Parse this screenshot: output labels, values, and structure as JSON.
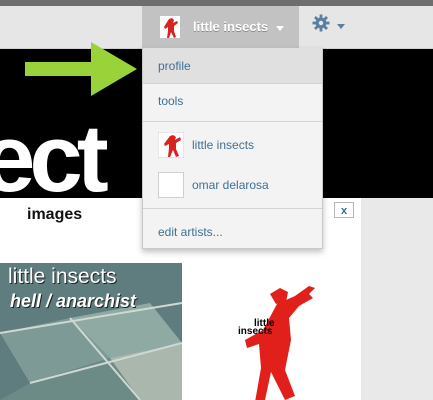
{
  "topbar": {
    "username": "little insects",
    "user_avatar_icon": "artist-avatar-icon",
    "gear_icon": "gear-icon"
  },
  "hero": {
    "text": "ect"
  },
  "content": {
    "images_label": "images",
    "close_label": "x",
    "album_title": "little insects",
    "album_subtitle": "hell / anarchist",
    "art_label_line1": "little",
    "art_label_line2": "insects"
  },
  "dropdown": {
    "items": [
      {
        "label": "profile",
        "active": true
      },
      {
        "label": "tools"
      },
      {
        "label": "little insects",
        "icon": "artist-avatar-icon"
      },
      {
        "label": "omar delarosa",
        "icon": "blank-avatar-icon"
      },
      {
        "label": "edit artists..."
      }
    ]
  },
  "colors": {
    "link": "#3f6f96",
    "arrow": "#9ad23a",
    "avatar_red": "#d9231f"
  }
}
